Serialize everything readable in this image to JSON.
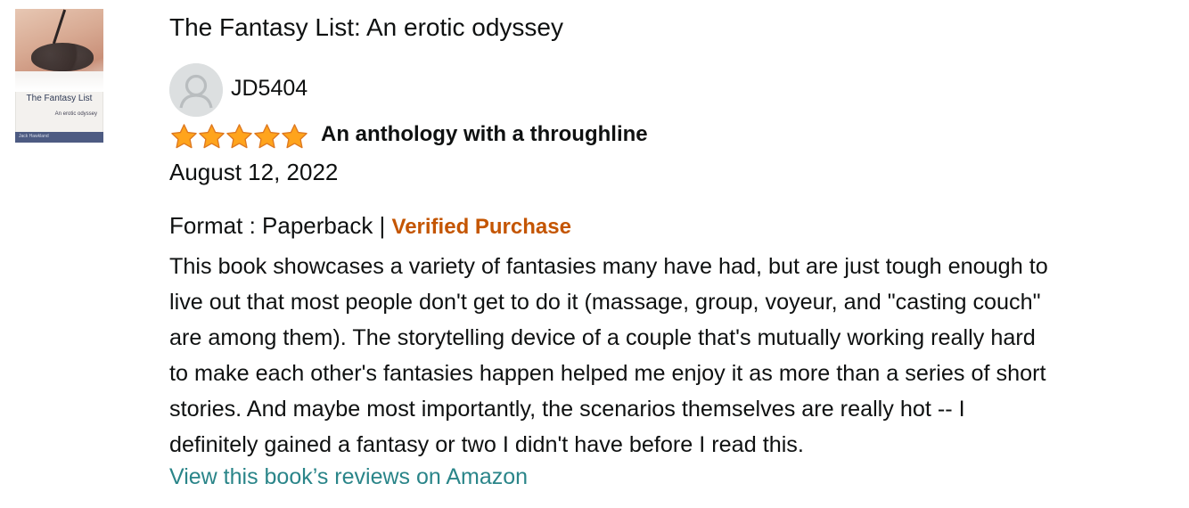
{
  "book": {
    "title": "The Fantasy List: An erotic odyssey",
    "cover": {
      "title": "The Fantasy List",
      "subtitle": "An erotic odyssey",
      "author": "Jack Hawkland"
    }
  },
  "review": {
    "reviewer": "JD5404",
    "avatar_icon": "default-user-avatar-icon",
    "rating": 5,
    "rating_max": 5,
    "star_color": "#ffa41c",
    "headline": "An anthology with a throughline",
    "date": "August 12, 2022",
    "format_label": "Format : Paperback",
    "separator": " | ",
    "verified": "Verified Purchase",
    "verified_color": "#c45500",
    "body_lines": [
      "This book showcases a variety of fantasies many have had, but are just tough enough to",
      "live out that most people don't get to do it (massage, group, voyeur, and \"casting couch\"",
      "are among them). The storytelling device of a couple that's mutually working really hard",
      "to make each other's fantasies happen helped me enjoy it as more than a series of short",
      "stories. And maybe most importantly, the scenarios themselves are really hot -- I",
      "definitely gained a fantasy or two I didn't have before I read this."
    ]
  },
  "link": {
    "label": "View this book’s reviews on Amazon",
    "color": "#2a8589"
  }
}
